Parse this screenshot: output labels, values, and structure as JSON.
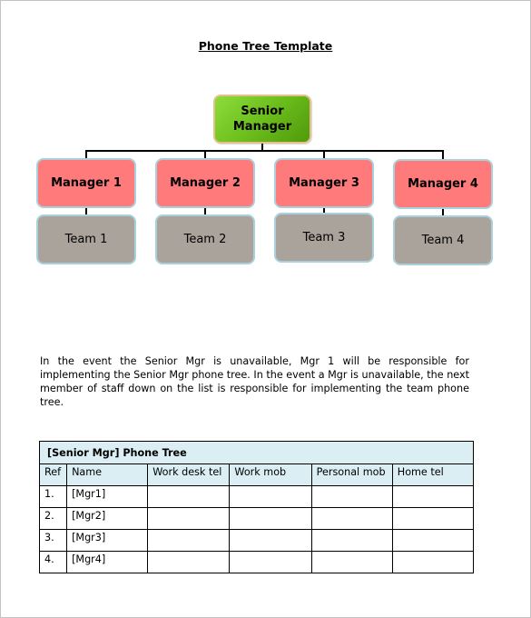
{
  "document": {
    "title": "Phone Tree Template",
    "org_chart": {
      "root": {
        "label_line1": "Senior",
        "label_line2": "Manager",
        "color": "#6cbe1c"
      },
      "managers": [
        {
          "label": "Manager 1",
          "team": "Team 1"
        },
        {
          "label": "Manager 2",
          "team": "Team 2"
        },
        {
          "label": "Manager 3",
          "team": "Team 3"
        },
        {
          "label": "Manager 4",
          "team": "Team 4"
        }
      ],
      "manager_color": "#ff7b7b",
      "team_color": "#aaa39c"
    },
    "paragraph": "In the event the Senior Mgr is unavailable, Mgr 1 will be responsible for implementing the Senior Mgr phone tree. In the event a Mgr is unavailable, the next member of staff down on the list is responsible for implementing the team phone tree.",
    "table": {
      "caption": "[Senior Mgr] Phone Tree",
      "columns": [
        "Ref",
        "Name",
        "Work desk tel",
        "Work mob",
        "Personal mob",
        "Home tel"
      ],
      "rows": [
        [
          "1.",
          "[Mgr1]",
          "",
          "",
          "",
          ""
        ],
        [
          "2.",
          "[Mgr2]",
          "",
          "",
          "",
          ""
        ],
        [
          "3.",
          "[Mgr3]",
          "",
          "",
          "",
          ""
        ],
        [
          "4.",
          "[Mgr4]",
          "",
          "",
          "",
          ""
        ]
      ]
    }
  }
}
